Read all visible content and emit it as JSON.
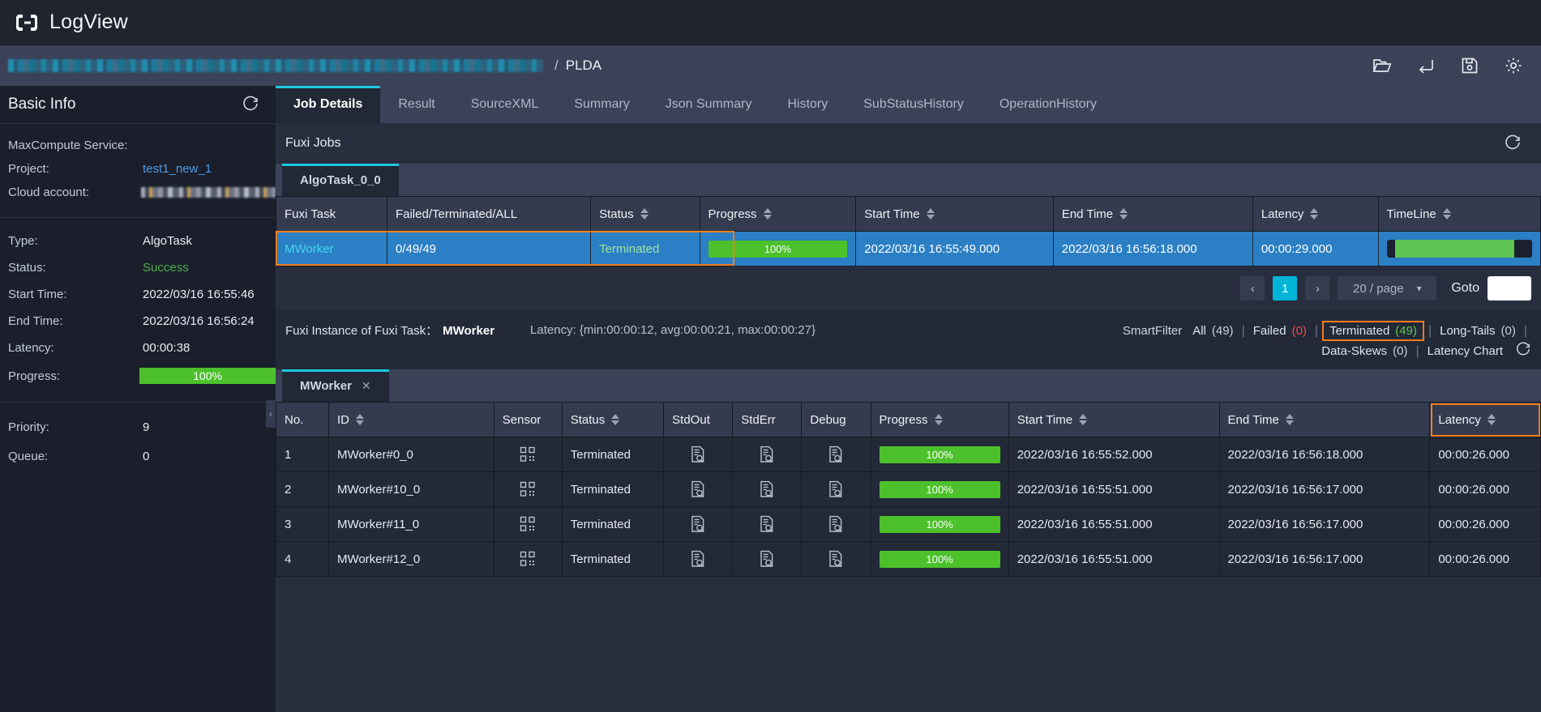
{
  "titlebar": {
    "app_title": "LogView",
    "logo_icon": "logview-logo-icon"
  },
  "breadcrumb": {
    "redacted_instance_id": "",
    "separator": "/",
    "current": "PLDA",
    "actions": [
      {
        "name": "open-folder-icon",
        "label": "Open"
      },
      {
        "name": "return-icon",
        "label": "Return"
      },
      {
        "name": "save-icon",
        "label": "Save"
      },
      {
        "name": "settings-gear-icon",
        "label": "Settings"
      }
    ]
  },
  "sidebar": {
    "title": "Basic Info",
    "refresh_icon": "refresh-icon",
    "collapse_handle": "‹",
    "group1": [
      {
        "label": "MaxCompute Service:",
        "value": "",
        "redacted": true,
        "kind": "a"
      },
      {
        "label": "Project:",
        "value": "test1_new_1",
        "kind": "link"
      },
      {
        "label": "Cloud account:",
        "value": "",
        "redacted": true,
        "kind": "b"
      }
    ],
    "group2": [
      {
        "label": "Type:",
        "value": "AlgoTask"
      },
      {
        "label": "Status:",
        "value": "Success",
        "kind": "ok"
      },
      {
        "label": "Start Time:",
        "value": "2022/03/16 16:55:46"
      },
      {
        "label": "End Time:",
        "value": "2022/03/16 16:56:24"
      },
      {
        "label": "Latency:",
        "value": "00:00:38"
      }
    ],
    "progress": {
      "label": "Progress:",
      "value": "100%",
      "percent": 100
    },
    "group3": [
      {
        "label": "Priority:",
        "value": "9"
      },
      {
        "label": "Queue:",
        "value": "0"
      }
    ]
  },
  "tabs": [
    {
      "label": "Job Details",
      "active": true
    },
    {
      "label": "Result",
      "active": false
    },
    {
      "label": "SourceXML",
      "active": false
    },
    {
      "label": "Summary",
      "active": false
    },
    {
      "label": "Json Summary",
      "active": false
    },
    {
      "label": "History",
      "active": false
    },
    {
      "label": "SubStatusHistory",
      "active": false
    },
    {
      "label": "OperationHistory",
      "active": false
    }
  ],
  "fuxi_jobs": {
    "section_title": "Fuxi Jobs",
    "refresh_icon": "refresh-icon",
    "inner_tab": "AlgoTask_0_0",
    "columns": [
      {
        "label": "Fuxi Task",
        "sortable": false
      },
      {
        "label": "Failed/Terminated/ALL",
        "sortable": false
      },
      {
        "label": "Status",
        "sortable": true
      },
      {
        "label": "Progress",
        "sortable": true
      },
      {
        "label": "Start Time",
        "sortable": true
      },
      {
        "label": "End Time",
        "sortable": true
      },
      {
        "label": "Latency",
        "sortable": true
      },
      {
        "label": "TimeLine",
        "sortable": true
      }
    ],
    "rows": [
      {
        "fuxi_task": "MWorker",
        "failed_terminated_all": "0/49/49",
        "status": "Terminated",
        "progress": "100%",
        "progress_percent": 100,
        "start_time": "2022/03/16 16:55:49.000",
        "end_time": "2022/03/16 16:56:18.000",
        "latency": "00:00:29.000",
        "timeline": {
          "start_percent": 6,
          "width_percent": 82
        },
        "selected": true,
        "highlighted": true
      }
    ],
    "pagination": {
      "prev": "‹",
      "next": "›",
      "pages": [
        "1"
      ],
      "current_page": "1",
      "page_size": "20 / page",
      "goto_label": "Goto",
      "goto_value": ""
    }
  },
  "fuxi_instance": {
    "title_prefix": "Fuxi Instance of Fuxi Task：",
    "task_name": "MWorker",
    "latency_summary": "Latency: {min:00:00:12, avg:00:00:21, max:00:00:27}",
    "smartfilter_label": "SmartFilter",
    "filters": [
      {
        "label": "All",
        "count": "(49)",
        "count_color": "default",
        "highlighted": false
      },
      {
        "label": "Failed",
        "count": "(0)",
        "count_color": "red",
        "highlighted": false
      },
      {
        "label": "Terminated",
        "count": "(49)",
        "count_color": "green",
        "highlighted": true
      },
      {
        "label": "Long-Tails",
        "count": "(0)",
        "count_color": "default",
        "highlighted": false
      },
      {
        "label": "Data-Skews",
        "count": "(0)",
        "count_color": "default",
        "highlighted": false
      }
    ],
    "latency_chart_label": "Latency Chart",
    "refresh_icon": "refresh-icon",
    "inner_tab": "MWorker",
    "inner_tab_close": "✕",
    "columns": [
      {
        "label": "No.",
        "sortable": false
      },
      {
        "label": "ID",
        "sortable": true
      },
      {
        "label": "Sensor",
        "sortable": false
      },
      {
        "label": "Status",
        "sortable": true
      },
      {
        "label": "StdOut",
        "sortable": false
      },
      {
        "label": "StdErr",
        "sortable": false
      },
      {
        "label": "Debug",
        "sortable": false
      },
      {
        "label": "Progress",
        "sortable": true
      },
      {
        "label": "Start Time",
        "sortable": true
      },
      {
        "label": "End Time",
        "sortable": true
      },
      {
        "label": "Latency",
        "sortable": true,
        "highlighted": true
      }
    ],
    "rows": [
      {
        "no": "1",
        "id": "MWorker#0_0",
        "sensor_icon": "qr-code-icon",
        "status": "Terminated",
        "stdout_icon": "log-search-icon",
        "stderr_icon": "log-search-icon",
        "debug_icon": "log-search-icon",
        "progress": "100%",
        "progress_percent": 100,
        "start_time": "2022/03/16 16:55:52.000",
        "end_time": "2022/03/16 16:56:18.000",
        "latency": "00:00:26.000"
      },
      {
        "no": "2",
        "id": "MWorker#10_0",
        "sensor_icon": "qr-code-icon",
        "status": "Terminated",
        "stdout_icon": "log-search-icon",
        "stderr_icon": "log-search-icon",
        "debug_icon": "log-search-icon",
        "progress": "100%",
        "progress_percent": 100,
        "start_time": "2022/03/16 16:55:51.000",
        "end_time": "2022/03/16 16:56:17.000",
        "latency": "00:00:26.000"
      },
      {
        "no": "3",
        "id": "MWorker#11_0",
        "sensor_icon": "qr-code-icon",
        "status": "Terminated",
        "stdout_icon": "log-search-icon",
        "stderr_icon": "log-search-icon",
        "debug_icon": "log-search-icon",
        "progress": "100%",
        "progress_percent": 100,
        "start_time": "2022/03/16 16:55:51.000",
        "end_time": "2022/03/16 16:56:17.000",
        "latency": "00:00:26.000"
      },
      {
        "no": "4",
        "id": "MWorker#12_0",
        "sensor_icon": "qr-code-icon",
        "status": "Terminated",
        "stdout_icon": "log-search-icon",
        "stderr_icon": "log-search-icon",
        "debug_icon": "log-search-icon",
        "progress": "100%",
        "progress_percent": 100,
        "start_time": "2022/03/16 16:55:51.000",
        "end_time": "2022/03/16 16:56:17.000",
        "latency": "00:00:26.000"
      }
    ]
  },
  "colors": {
    "accent_cyan": "#1ec8e0",
    "highlight_orange": "#f07d1b",
    "select_blue": "#2b7fc4",
    "progress_green": "#4cc12b",
    "status_green": "#4cae4c",
    "error_red": "#ef4a4a",
    "link_blue": "#4a9be8"
  }
}
